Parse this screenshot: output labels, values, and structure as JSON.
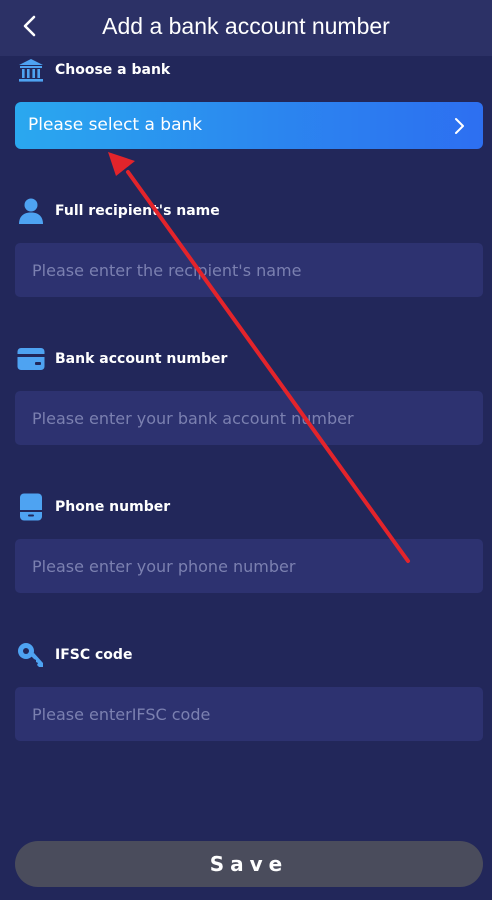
{
  "header": {
    "title": "Add a bank account number",
    "back_icon": "chevron-left-icon"
  },
  "bank": {
    "label": "Choose a bank",
    "icon": "bank-icon",
    "select_text": "Please select a bank",
    "chevron_icon": "chevron-right-icon"
  },
  "recipient": {
    "label": "Full recipient's name",
    "icon": "person-icon",
    "placeholder": "Please enter the recipient's name"
  },
  "account": {
    "label": "Bank account number",
    "icon": "card-icon",
    "placeholder": "Please enter your bank account number"
  },
  "phone": {
    "label": "Phone number",
    "icon": "phone-icon",
    "placeholder": "Please enter your phone number"
  },
  "ifsc": {
    "label": "IFSC code",
    "icon": "key-icon",
    "placeholder": "Please enterIFSC code"
  },
  "save": {
    "label": "Save"
  },
  "colors": {
    "background": "#22275a",
    "header": "#2c3166",
    "field": "#2d3270",
    "accent_start": "#2aa8ef",
    "accent_end": "#2d6ff1",
    "icon": "#4ea3f2",
    "annotation_arrow": "#e3242b",
    "save_button": "#4a4c5c"
  }
}
